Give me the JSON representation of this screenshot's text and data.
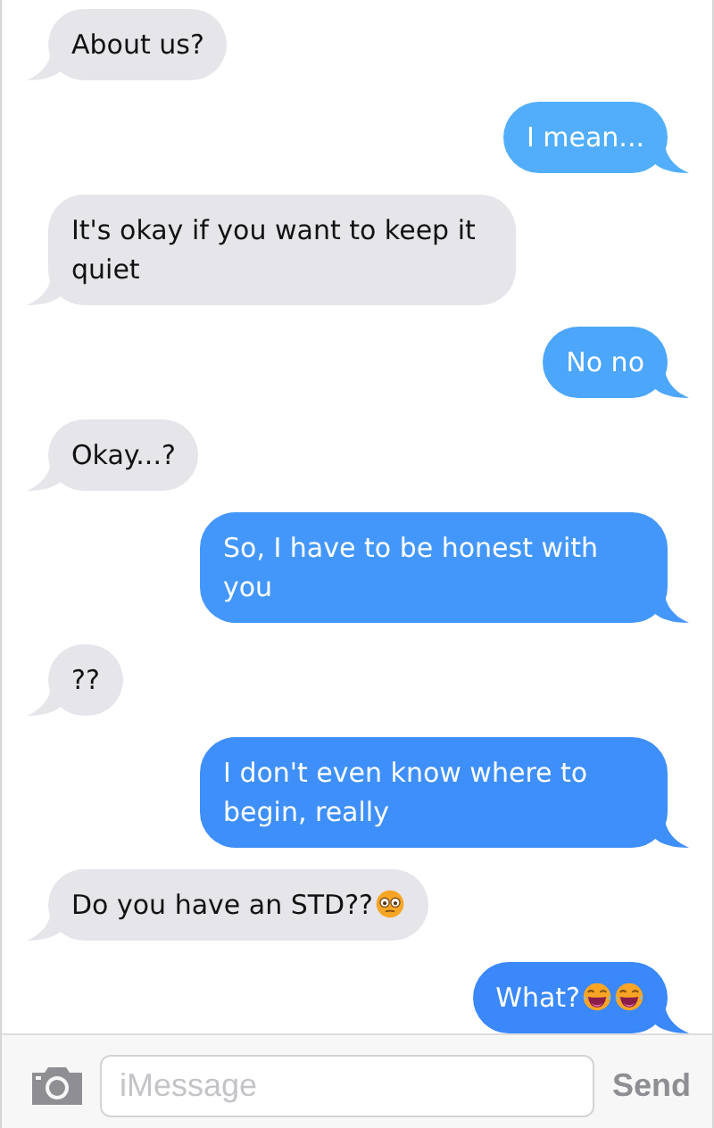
{
  "messages": [
    {
      "kind": "received",
      "text": "About us?"
    },
    {
      "kind": "sent",
      "text": "I mean...",
      "color": "#52aefa"
    },
    {
      "kind": "received",
      "text": "It's okay if you want to keep it quiet"
    },
    {
      "kind": "sent",
      "text": "No no",
      "color": "#4ca6fa"
    },
    {
      "kind": "received",
      "text": "Okay...?"
    },
    {
      "kind": "sent",
      "text": "So, I have to be honest with you",
      "color": "#4497fa"
    },
    {
      "kind": "received",
      "text": "??"
    },
    {
      "kind": "sent",
      "text": "I don't even know where to begin, really",
      "color": "#3e8ff9"
    },
    {
      "kind": "received",
      "text": "Do you have an STD??",
      "emojis": [
        {
          "kind": "flushed"
        }
      ]
    },
    {
      "kind": "sent",
      "text": "What?",
      "color": "#3a88f9",
      "emojis": [
        {
          "kind": "laughing"
        },
        {
          "kind": "laughing"
        }
      ]
    }
  ],
  "composer": {
    "placeholder": "iMessage",
    "send": "Send"
  }
}
